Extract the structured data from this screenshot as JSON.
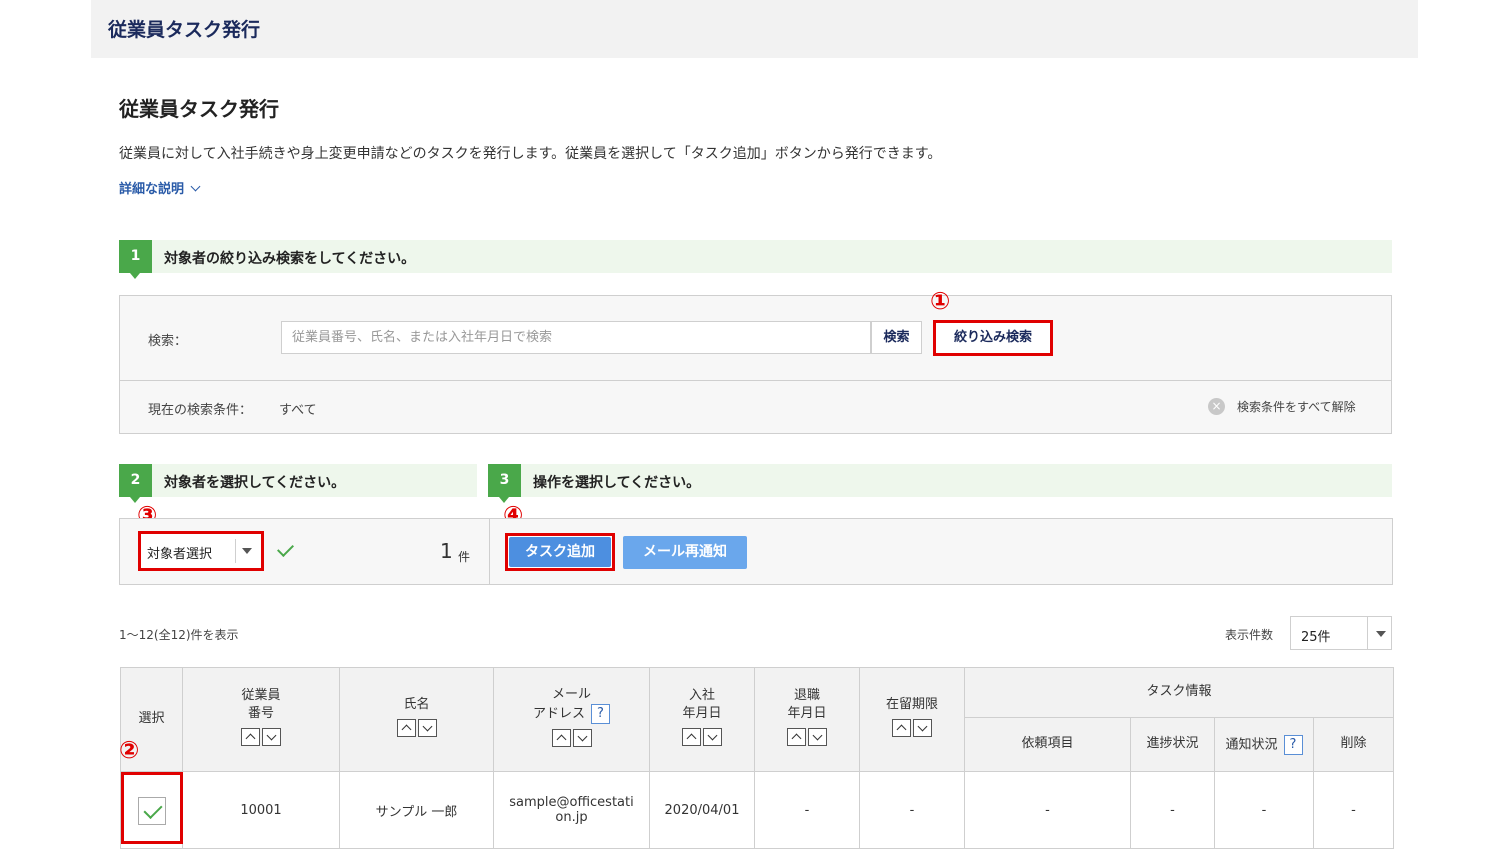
{
  "header": {
    "title": "従業員タスク発行"
  },
  "page": {
    "title": "従業員タスク発行",
    "description": "従業員に対して入社手続きや身上変更申請などのタスクを発行します。従業員を選択して「タスク追加」ボタンから発行できます。",
    "detail_link": "詳細な説明"
  },
  "steps": [
    {
      "num": "1",
      "text": "対象者の絞り込み検索をしてください。"
    },
    {
      "num": "2",
      "text": "対象者を選択してください。"
    },
    {
      "num": "3",
      "text": "操作を選択してください。"
    }
  ],
  "search": {
    "label": "検索：",
    "placeholder": "従業員番号、氏名、または入社年月日で検索",
    "search_button": "検索",
    "filter_button": "絞り込み検索",
    "condition_label": "現在の検索条件：",
    "condition_value": "すべて",
    "clear_all": "検索条件をすべて解除",
    "clear_icon": "×"
  },
  "selection": {
    "dropdown_label": "対象者選択",
    "count": "1",
    "count_unit": "件"
  },
  "operations": {
    "add_task": "タスク追加",
    "mail_resend": "メール再通知"
  },
  "annotations": [
    "①",
    "②",
    "③",
    "④"
  ],
  "list": {
    "range_text": "1〜12(全12)件を表示",
    "per_page_label": "表示件数",
    "per_page_value": "25件"
  },
  "table": {
    "headers": {
      "select": "選択",
      "emp_no_1": "従業員",
      "emp_no_2": "番号",
      "name": "氏名",
      "mail_1": "メール",
      "mail_2": "アドレス",
      "join_1": "入社",
      "join_2": "年月日",
      "retire_1": "退職",
      "retire_2": "年月日",
      "residence": "在留期限",
      "task_info": "タスク情報",
      "request_item": "依頼項目",
      "progress": "進捗状況",
      "notify": "通知状況",
      "delete": "削除",
      "help": "?"
    },
    "rows": [
      {
        "emp_no": "10001",
        "name": "サンプル 一郎",
        "email_1": "sample@officestati",
        "email_2": "on.jp",
        "join_date": "2020/04/01",
        "retire_date": "-",
        "residence": "-",
        "request_item": "-",
        "progress": "-",
        "notify": "-",
        "delete": "-"
      }
    ]
  }
}
